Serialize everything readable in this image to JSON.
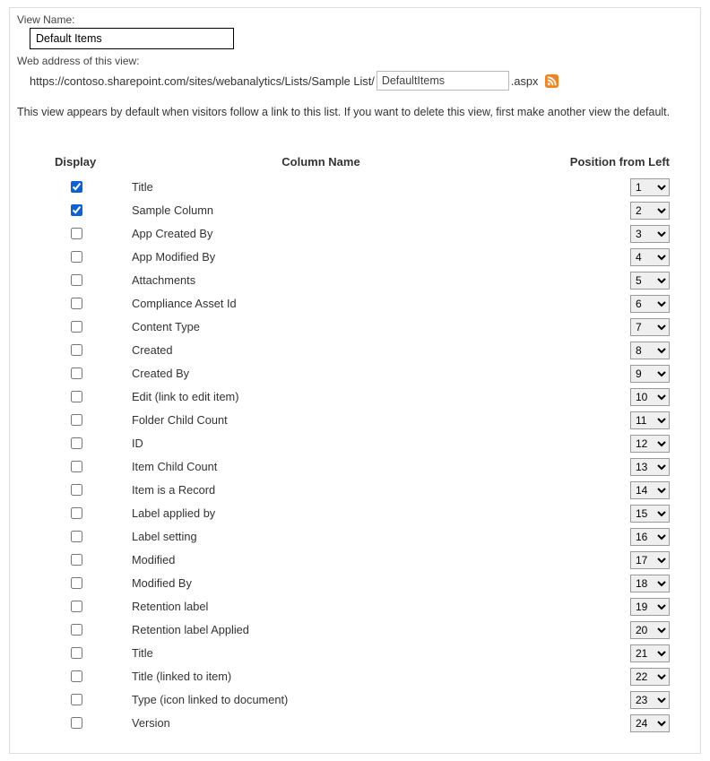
{
  "labels": {
    "view_name_label": "View Name:",
    "web_address_label": "Web address of this view:"
  },
  "form": {
    "view_name_value": "Default Items",
    "url_prefix": "https://contoso.sharepoint.com/sites/webanalytics/Lists/Sample List/",
    "url_value": "DefaultItems",
    "url_suffix": ".aspx"
  },
  "description": "This view appears by default when visitors follow a link to this list. If you want to delete this view, first make another view the default.",
  "headers": {
    "display": "Display",
    "column_name": "Column Name",
    "position": "Position from Left"
  },
  "max_position": 24,
  "columns": [
    {
      "name": "Title",
      "display": true,
      "position": 1
    },
    {
      "name": "Sample Column",
      "display": true,
      "position": 2
    },
    {
      "name": "App Created By",
      "display": false,
      "position": 3
    },
    {
      "name": "App Modified By",
      "display": false,
      "position": 4
    },
    {
      "name": "Attachments",
      "display": false,
      "position": 5
    },
    {
      "name": "Compliance Asset Id",
      "display": false,
      "position": 6
    },
    {
      "name": "Content Type",
      "display": false,
      "position": 7
    },
    {
      "name": "Created",
      "display": false,
      "position": 8
    },
    {
      "name": "Created By",
      "display": false,
      "position": 9
    },
    {
      "name": "Edit (link to edit item)",
      "display": false,
      "position": 10
    },
    {
      "name": "Folder Child Count",
      "display": false,
      "position": 11
    },
    {
      "name": "ID",
      "display": false,
      "position": 12
    },
    {
      "name": "Item Child Count",
      "display": false,
      "position": 13
    },
    {
      "name": "Item is a Record",
      "display": false,
      "position": 14
    },
    {
      "name": "Label applied by",
      "display": false,
      "position": 15
    },
    {
      "name": "Label setting",
      "display": false,
      "position": 16
    },
    {
      "name": "Modified",
      "display": false,
      "position": 17
    },
    {
      "name": "Modified By",
      "display": false,
      "position": 18
    },
    {
      "name": "Retention label",
      "display": false,
      "position": 19
    },
    {
      "name": "Retention label Applied",
      "display": false,
      "position": 20
    },
    {
      "name": "Title",
      "display": false,
      "position": 21
    },
    {
      "name": "Title (linked to item)",
      "display": false,
      "position": 22
    },
    {
      "name": "Type (icon linked to document)",
      "display": false,
      "position": 23
    },
    {
      "name": "Version",
      "display": false,
      "position": 24
    }
  ]
}
